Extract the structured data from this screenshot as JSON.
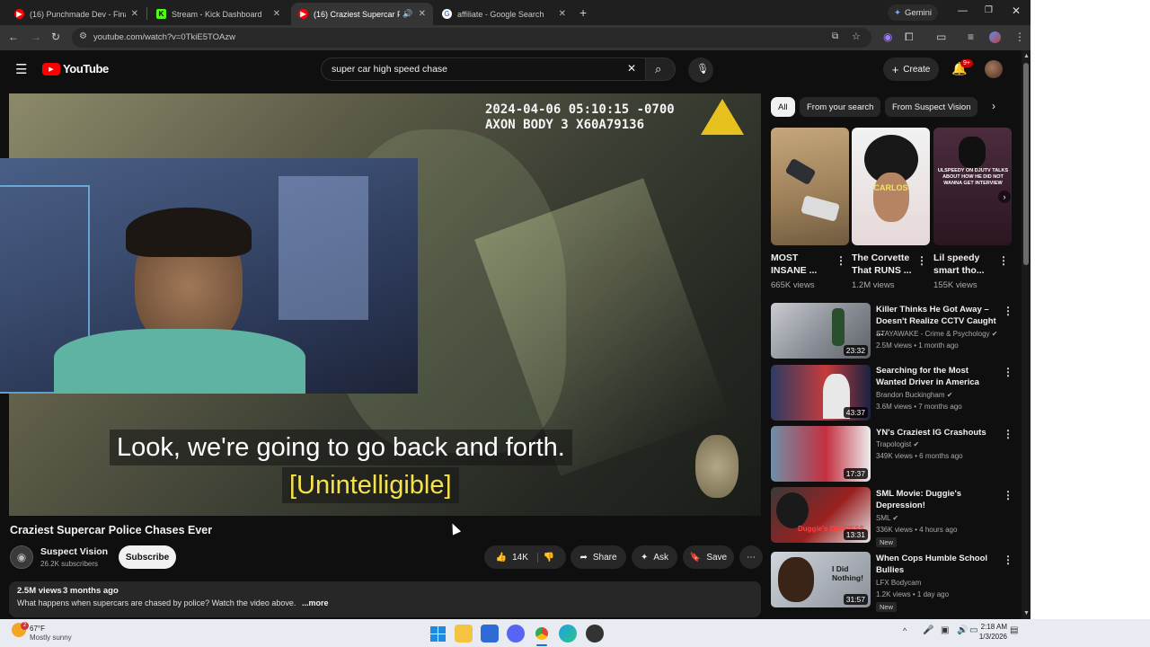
{
  "browser": {
    "tabs": [
      {
        "label": "(16) Punchmade Dev - Financia",
        "favicon": "youtube-icon",
        "active": false
      },
      {
        "label": "Stream - Kick Dashboard",
        "favicon": "kick-icon",
        "active": false
      },
      {
        "label": "(16) Craziest Supercar Polic",
        "favicon": "youtube-icon",
        "active": true
      },
      {
        "label": "affiliate - Google Search",
        "favicon": "google-icon",
        "active": false
      }
    ],
    "gemini_label": "Gemini",
    "url": "youtube.com/watch?v=0TkiE5TOAzw"
  },
  "youtube": {
    "logo_text": "YouTube",
    "search_value": "super car high speed chase",
    "create_label": "Create",
    "notification_count": "9+"
  },
  "player": {
    "bodycam_line1": "2024-04-06 05:10:15 -0700",
    "bodycam_line2": "AXON BODY 3 X60A79136",
    "caption_line1": "Look, we're going to go back and forth.",
    "caption_line2": "[Unintelligible]"
  },
  "video": {
    "title": "Craziest Supercar Police Chases Ever",
    "channel": "Suspect Vision",
    "subscribers": "26.2K subscribers",
    "subscribe_label": "Subscribe",
    "likes": "14K",
    "share_label": "Share",
    "ask_label": "Ask",
    "save_label": "Save",
    "views": "2.5M views",
    "age": "3 months ago",
    "description": "What happens when supercars are chased by police? Watch the video above.",
    "more_label": "...more"
  },
  "chips": [
    "All",
    "From your search",
    "From Suspect Vision"
  ],
  "shorts": [
    {
      "title": "MOST INSANE ...",
      "views": "665K views"
    },
    {
      "title": "The Corvette That RUNS ...",
      "views": "1.2M views",
      "thumb_text": "CARLOS"
    },
    {
      "title": "Lil speedy smart tho...",
      "views": "155K views",
      "thumb_text": "ULSPEEDY ON DJUTV TALKS ABOUT HOW HE DID NOT WANNA GET INTERVIEW"
    }
  ],
  "recommendations": [
    {
      "title": "Killer Thinks He Got Away – Doesn't Realize CCTV Caught ...",
      "channel": "STAYAWAKE - Crime & Psychology",
      "meta": "2.5M views • 1 month ago",
      "duration": "23:32",
      "verified": true,
      "is_new": false
    },
    {
      "title": "Searching for the Most Wanted Driver in America",
      "channel": "Brandon Buckingham",
      "meta": "3.6M views • 7 months ago",
      "duration": "43:37",
      "verified": true,
      "is_new": false
    },
    {
      "title": "YN's Craziest IG Crashouts",
      "channel": "Trapologist",
      "meta": "349K views • 6 months ago",
      "duration": "17:37",
      "verified": true,
      "is_new": false
    },
    {
      "title": "SML Movie: Duggie's Depression!",
      "channel": "SML",
      "meta": "336K views • 4 hours ago",
      "duration": "13:31",
      "verified": true,
      "is_new": true,
      "new_label": "New",
      "thumb_text": "Duggie's DEPRESS"
    },
    {
      "title": "When Cops Humble School Bullies",
      "channel": "LFX Bodycam",
      "meta": "1.2K views • 1 day ago",
      "duration": "31:57",
      "verified": false,
      "is_new": true,
      "new_label": "New",
      "thumb_text": "I Did Nothing!"
    }
  ],
  "taskbar": {
    "weather_temp": "67°F",
    "weather_desc": "Mostly sunny",
    "weather_badge": "2",
    "time": "2:18 AM",
    "date": "1/3/2026"
  },
  "colors": {
    "youtube_red": "#ff0000",
    "kick_green": "#53fc18",
    "chip_selected": "#f1f1f1"
  }
}
